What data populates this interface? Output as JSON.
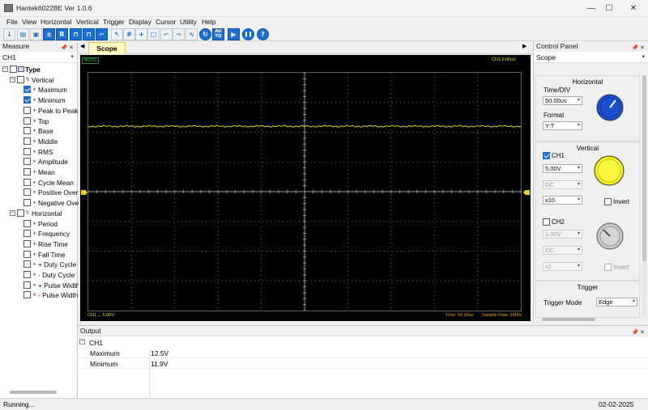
{
  "window": {
    "title": "Hantek6022BE Ver 1.0.6",
    "minimize": "—",
    "maximize": "☐",
    "close": "✕"
  },
  "menu": [
    "File",
    "View",
    "Horizontal",
    "Vertical",
    "Trigger",
    "Display",
    "Cursor",
    "Utility",
    "Help"
  ],
  "toolbar": {
    "auto_label": "AU\nTO",
    "help_label": "?",
    "run_label": "▶",
    "stop_label": "❚❚"
  },
  "measure_panel": {
    "title": "Measure",
    "pin": "📌 ✕",
    "channel": "CH1",
    "tree": {
      "root": "Type",
      "vertical": {
        "label": "Vertical",
        "items": [
          {
            "label": "Maximum",
            "checked": true
          },
          {
            "label": "Minimum",
            "checked": true
          },
          {
            "label": "Peak to Peak",
            "checked": false
          },
          {
            "label": "Top",
            "checked": false
          },
          {
            "label": "Base",
            "checked": false
          },
          {
            "label": "Middle",
            "checked": false
          },
          {
            "label": "RMS",
            "checked": false
          },
          {
            "label": "Amplitude",
            "checked": false
          },
          {
            "label": "Mean",
            "checked": false
          },
          {
            "label": "Cycle Mean",
            "checked": false
          },
          {
            "label": "Positive Overshoot",
            "checked": false
          },
          {
            "label": "Negative Overshoot",
            "checked": false
          }
        ]
      },
      "horizontal": {
        "label": "Horizontal",
        "items": [
          {
            "label": "Period",
            "checked": false,
            "mark": "♦"
          },
          {
            "label": "Frequency",
            "checked": false,
            "mark": "♦"
          },
          {
            "label": "Rise Time",
            "checked": false,
            "mark": "♦"
          },
          {
            "label": "Fall Time",
            "checked": false,
            "mark": "♦"
          },
          {
            "label": "+ Duty Cycle",
            "checked": false,
            "mark": "♦"
          },
          {
            "label": "- Duty Cycle",
            "checked": false,
            "mark": "♦"
          },
          {
            "label": "+ Pulse Width",
            "checked": false,
            "mark": "♦"
          },
          {
            "label": "- Pulse Width",
            "checked": false,
            "mark": "♦"
          }
        ]
      }
    }
  },
  "scope": {
    "tab_label": "Scope",
    "nav_left": "◀",
    "nav_right": "▶",
    "mode_badge": "AUTO",
    "trigger_readout": "CH1 0.00uV",
    "ch_readout": "CH1 ... 5.00V",
    "time_readout": "Time: 50.00us",
    "sample_rate": "Sample Rate: 1MHz",
    "trace_color": "#d8d820",
    "trace_level_div": 2.2
  },
  "control_panel": {
    "title": "Control Panel",
    "pin": "📌 ✕",
    "mode": "Scope",
    "horizontal": {
      "title": "Horizontal",
      "timediv_label": "Time/DIV",
      "timediv_value": "50.00us",
      "format_label": "Format",
      "format_value": "Y-T",
      "knob_color": "#1a4fcf"
    },
    "vertical": {
      "title": "Vertical",
      "ch1_label": "CH1",
      "ch1_enabled": true,
      "ch1_volts": "5.00V",
      "ch1_coupling": "DC",
      "ch1_probe": "x10",
      "ch1_invert": "Invert",
      "ch1_knob_color": "#f2f21a",
      "ch2_label": "CH2",
      "ch2_enabled": false,
      "ch2_volts": "1.00V",
      "ch2_coupling": "DC",
      "ch2_probe": "x1",
      "ch2_invert": "Invert",
      "ch2_knob_color": "#c8c8c8"
    },
    "trigger": {
      "title": "Trigger",
      "mode_label": "Trigger Mode",
      "mode_value": "Edge"
    }
  },
  "output": {
    "title": "Output",
    "pin": "📌 ✕",
    "channel": "CH1",
    "rows": [
      {
        "name": "Maximum",
        "value": "12.5V"
      },
      {
        "name": "Minimum",
        "value": "11.9V"
      }
    ]
  },
  "status": {
    "left": "Running...",
    "right": "02-02-2025"
  }
}
